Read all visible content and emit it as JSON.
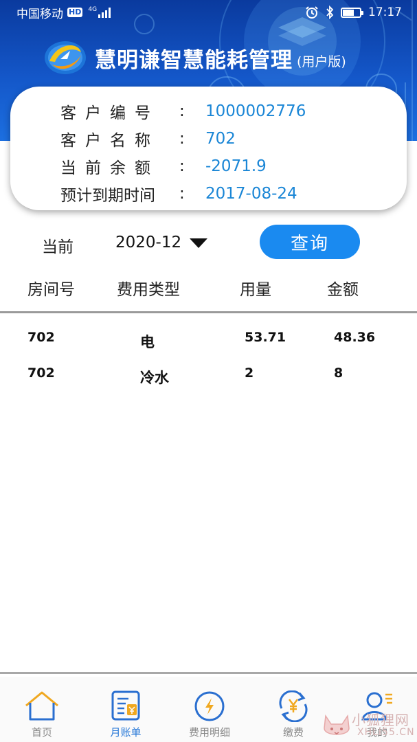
{
  "status_bar": {
    "carrier": "中国移动",
    "hd_badge": "HD",
    "network": "4G",
    "time": "17:17"
  },
  "header": {
    "title": "慧明谦智慧能耗管理",
    "subtitle": "(用户版)",
    "logo_icon": "company-logo"
  },
  "customer": [
    {
      "label": "客户编号",
      "value": "1000002776"
    },
    {
      "label": "客户名称",
      "value": "702"
    },
    {
      "label": "当前余额",
      "value": "-2071.9"
    },
    {
      "label": "预计到期时间",
      "value": "2017-08-24"
    }
  ],
  "colon": ":",
  "query": {
    "label": "当前",
    "month": "2020-12",
    "button_label": "查询"
  },
  "table": {
    "headers": [
      "房间号",
      "费用类型",
      "用量",
      "金额"
    ],
    "rows": [
      [
        "702",
        "电",
        "53.71",
        "48.36"
      ],
      [
        "702",
        "冷水",
        "2",
        "8"
      ]
    ]
  },
  "bottom_nav": [
    {
      "label": "首页",
      "icon": "home-icon",
      "active": false
    },
    {
      "label": "月账单",
      "icon": "monthly-bill-icon",
      "active": true
    },
    {
      "label": "费用明细",
      "icon": "lightning-icon",
      "active": false
    },
    {
      "label": "缴费",
      "icon": "yuan-refresh-icon",
      "active": false
    },
    {
      "label": "我的",
      "icon": "user-icon",
      "active": false
    }
  ],
  "watermark": {
    "text": "小狐狸网",
    "domain": "XHLI55.CN"
  },
  "colors": {
    "header_blue": "#1457c9",
    "value_blue": "#1a86d6",
    "button_blue": "#1a8af0",
    "nav_active": "#2a7ad8"
  }
}
